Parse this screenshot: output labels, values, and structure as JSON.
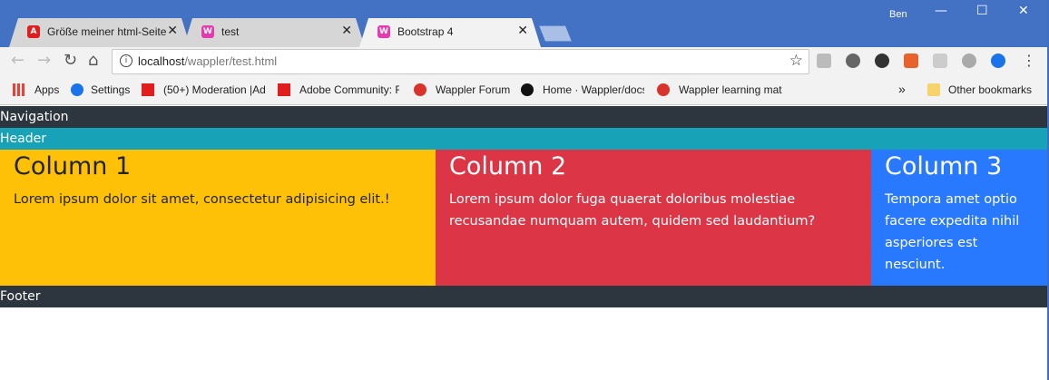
{
  "browser": {
    "tabs": [
      {
        "title": "Größe meiner html-Seite",
        "favicon": "adobe-icon",
        "active": false
      },
      {
        "title": "test",
        "favicon": "wappler-icon",
        "active": false
      },
      {
        "title": "Bootstrap 4",
        "favicon": "wappler-icon",
        "active": true
      }
    ],
    "user": "Ben",
    "address": {
      "host": "localhost",
      "path": "/wappler/test.html"
    },
    "bookmarks": [
      {
        "label": "Apps",
        "icon": "apps-grid-icon"
      },
      {
        "label": "Settings",
        "icon": "gear-icon"
      },
      {
        "label": "(50+) Moderation |Ad",
        "icon": "adobe-icon"
      },
      {
        "label": "Adobe Community: F",
        "icon": "adobe-icon"
      },
      {
        "label": "Wappler Forum",
        "icon": "wappler-icon"
      },
      {
        "label": "Home · Wappler/docs",
        "icon": "github-icon"
      },
      {
        "label": "Wappler learning mat",
        "icon": "wappler-icon"
      }
    ],
    "other_bookmarks": "Other bookmarks",
    "colors": {
      "titlebar": "#4371c4",
      "toolbar": "#f2f2f2"
    }
  },
  "page": {
    "nav": "Navigation",
    "header": "Header",
    "columns": [
      {
        "title": "Column 1",
        "text": "Lorem ipsum dolor sit amet, consectetur adipisicing elit.!",
        "color": "#ffc107"
      },
      {
        "title": "Column 2",
        "text": "Lorem ipsum dolor fuga quaerat doloribus molestiae recusandae numquam autem, quidem sed laudantium?",
        "color": "#dc3545"
      },
      {
        "title": "Column 3",
        "text": "Tempora amet optio facere expedita nihil asperiores est nesciunt.",
        "color": "#2979ff"
      }
    ],
    "footer": "Footer"
  }
}
